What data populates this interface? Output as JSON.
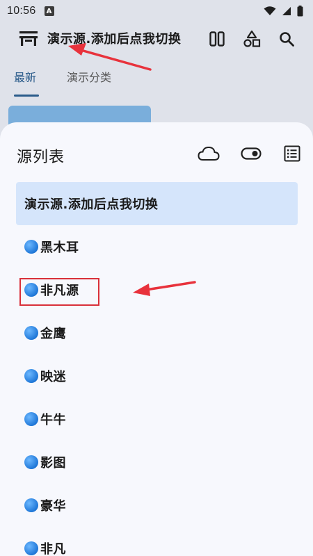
{
  "status_bar": {
    "time": "10:56",
    "notif_glyph": "A"
  },
  "app_bar": {
    "title": "演示源.添加后点我切换"
  },
  "tabs": [
    {
      "label": "最新",
      "active": true
    },
    {
      "label": "演示分类",
      "active": false
    }
  ],
  "sheet": {
    "title": "源列表",
    "sources": [
      {
        "label": "演示源.添加后点我切换",
        "selected": true,
        "dot": false
      },
      {
        "label": "黑木耳",
        "dot": true
      },
      {
        "label": "非凡源",
        "dot": true,
        "highlighted": true
      },
      {
        "label": "金鹰",
        "dot": true
      },
      {
        "label": "映迷",
        "dot": true
      },
      {
        "label": "牛牛",
        "dot": true
      },
      {
        "label": "影图",
        "dot": true
      },
      {
        "label": "豪华",
        "dot": true
      },
      {
        "label": "非凡",
        "dot": true
      }
    ]
  },
  "colors": {
    "accent": "#2a5b8a",
    "selected_bg": "#d5e5fb",
    "annotation": "#d9303a"
  }
}
